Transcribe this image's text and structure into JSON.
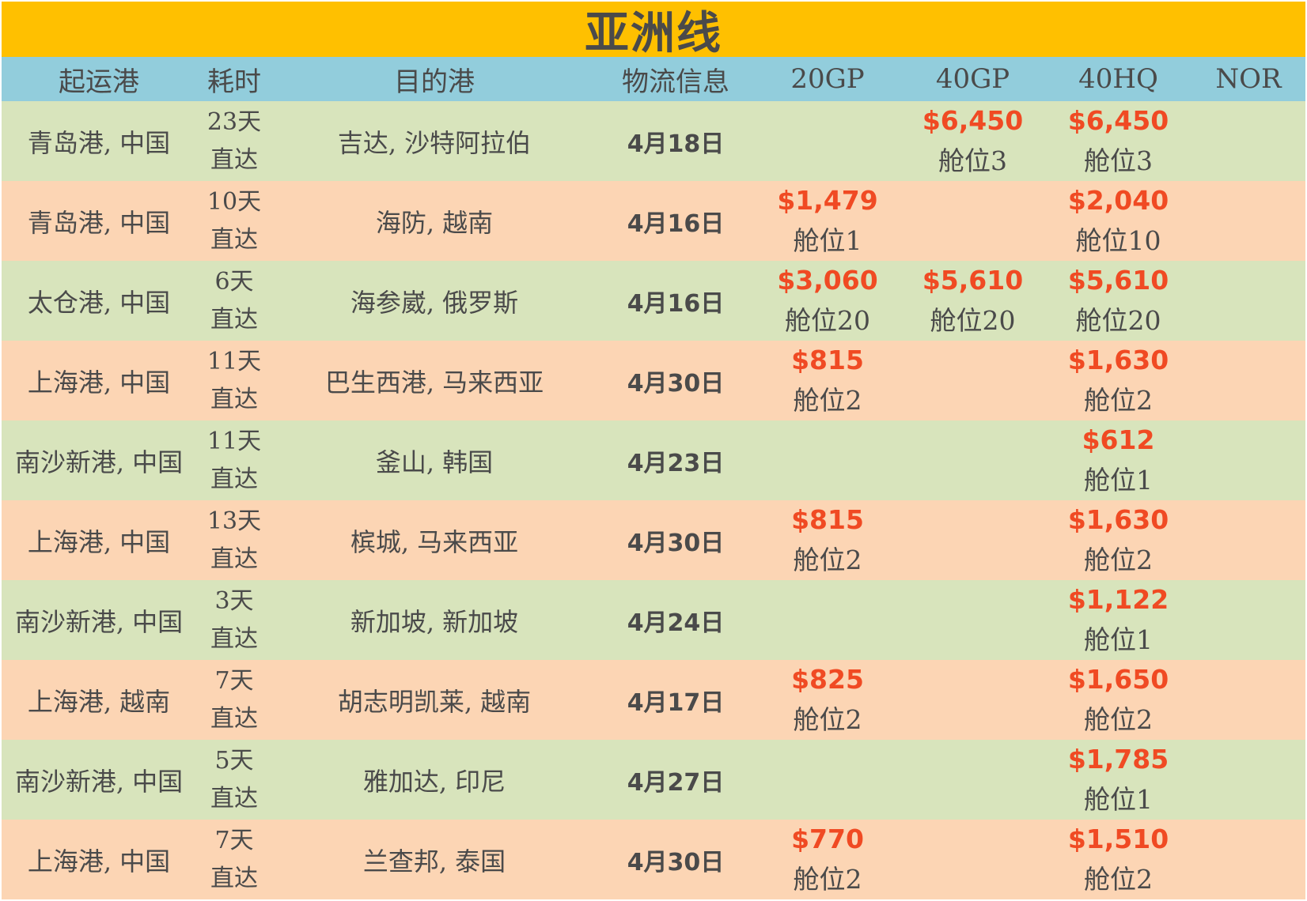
{
  "title": "亚洲线",
  "headers": [
    "起运港",
    "耗时",
    "目的港",
    "物流信息",
    "20GP",
    "40GP",
    "40HQ",
    "NOR"
  ],
  "rows": [
    {
      "origin": "青岛港, 中国",
      "days": "23天",
      "route": "直达",
      "dest": "吉达, 沙特阿拉伯",
      "date": "4月18日",
      "gp20": {
        "price": "",
        "slot": ""
      },
      "gp40": {
        "price": "$6,450",
        "slot": "舱位3"
      },
      "hq40": {
        "price": "$6,450",
        "slot": "舱位3"
      },
      "nor": ""
    },
    {
      "origin": "青岛港, 中国",
      "days": "10天",
      "route": "直达",
      "dest": "海防, 越南",
      "date": "4月16日",
      "gp20": {
        "price": "$1,479",
        "slot": "舱位1"
      },
      "gp40": {
        "price": "",
        "slot": ""
      },
      "hq40": {
        "price": "$2,040",
        "slot": "舱位10"
      },
      "nor": ""
    },
    {
      "origin": "太仓港, 中国",
      "days": "6天",
      "route": "直达",
      "dest": "海参崴, 俄罗斯",
      "date": "4月16日",
      "gp20": {
        "price": "$3,060",
        "slot": "舱位20"
      },
      "gp40": {
        "price": "$5,610",
        "slot": "舱位20"
      },
      "hq40": {
        "price": "$5,610",
        "slot": "舱位20"
      },
      "nor": ""
    },
    {
      "origin": "上海港, 中国",
      "days": "11天",
      "route": "直达",
      "dest": "巴生西港, 马来西亚",
      "date": "4月30日",
      "gp20": {
        "price": "$815",
        "slot": "舱位2"
      },
      "gp40": {
        "price": "",
        "slot": ""
      },
      "hq40": {
        "price": "$1,630",
        "slot": "舱位2"
      },
      "nor": ""
    },
    {
      "origin": "南沙新港, 中国",
      "days": "11天",
      "route": "直达",
      "dest": "釜山, 韩国",
      "date": "4月23日",
      "gp20": {
        "price": "",
        "slot": ""
      },
      "gp40": {
        "price": "",
        "slot": ""
      },
      "hq40": {
        "price": "$612",
        "slot": "舱位1"
      },
      "nor": ""
    },
    {
      "origin": "上海港, 中国",
      "days": "13天",
      "route": "直达",
      "dest": "槟城, 马来西亚",
      "date": "4月30日",
      "gp20": {
        "price": "$815",
        "slot": "舱位2"
      },
      "gp40": {
        "price": "",
        "slot": ""
      },
      "hq40": {
        "price": "$1,630",
        "slot": "舱位2"
      },
      "nor": ""
    },
    {
      "origin": "南沙新港, 中国",
      "days": "3天",
      "route": "直达",
      "dest": "新加坡, 新加坡",
      "date": "4月24日",
      "gp20": {
        "price": "",
        "slot": ""
      },
      "gp40": {
        "price": "",
        "slot": ""
      },
      "hq40": {
        "price": "$1,122",
        "slot": "舱位1"
      },
      "nor": ""
    },
    {
      "origin": "上海港, 越南",
      "days": "7天",
      "route": "直达",
      "dest": "胡志明凯莱, 越南",
      "date": "4月17日",
      "gp20": {
        "price": "$825",
        "slot": "舱位2"
      },
      "gp40": {
        "price": "",
        "slot": ""
      },
      "hq40": {
        "price": "$1,650",
        "slot": "舱位2"
      },
      "nor": ""
    },
    {
      "origin": "南沙新港, 中国",
      "days": "5天",
      "route": "直达",
      "dest": "雅加达, 印尼",
      "date": "4月27日",
      "gp20": {
        "price": "",
        "slot": ""
      },
      "gp40": {
        "price": "",
        "slot": ""
      },
      "hq40": {
        "price": "$1,785",
        "slot": "舱位1"
      },
      "nor": ""
    },
    {
      "origin": "上海港, 中国",
      "days": "7天",
      "route": "直达",
      "dest": "兰查邦, 泰国",
      "date": "4月30日",
      "gp20": {
        "price": "$770",
        "slot": "舱位2"
      },
      "gp40": {
        "price": "",
        "slot": ""
      },
      "hq40": {
        "price": "$1,510",
        "slot": "舱位2"
      },
      "nor": ""
    }
  ],
  "colors": {
    "title_bg": "#ffc000",
    "header_bg": "#92cddc",
    "row_green": "#d8e4bc",
    "row_peach": "#fcd5b4",
    "price": "#f04a23",
    "text": "#4a4a4a"
  }
}
